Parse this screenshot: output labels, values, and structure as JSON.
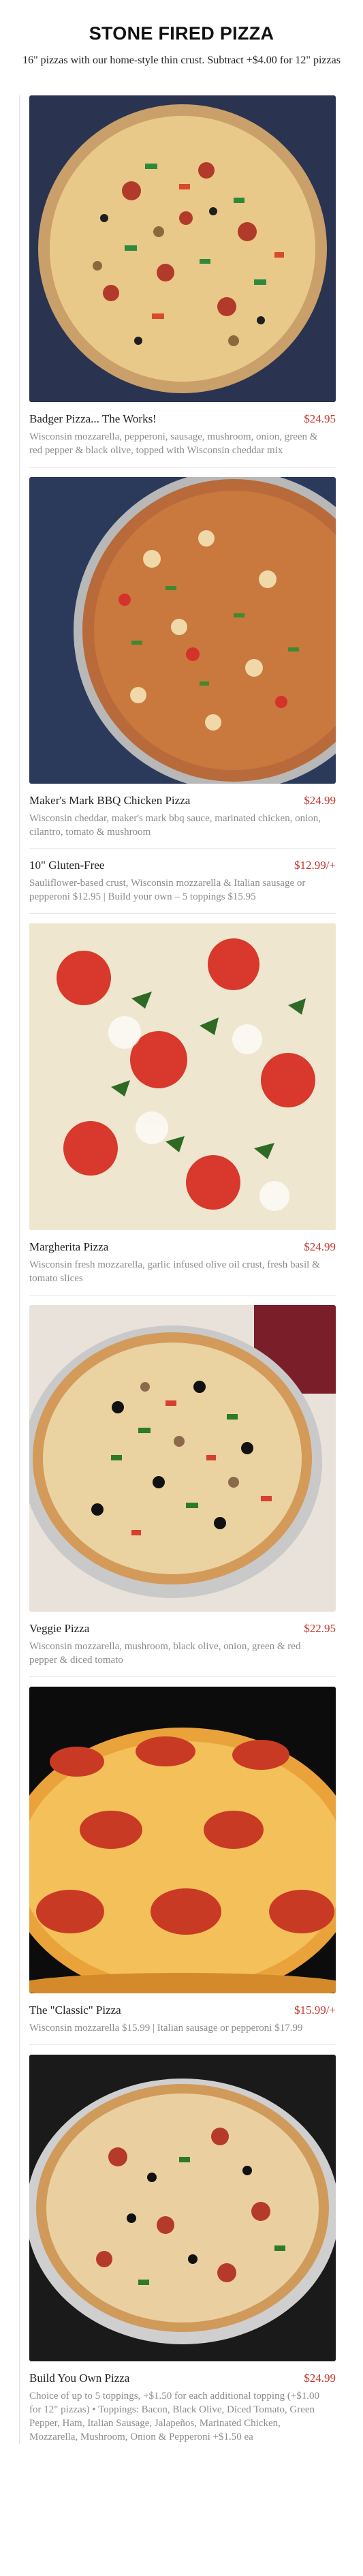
{
  "header": {
    "title": "STONE FIRED PIZZA",
    "subtitle": "16\" pizzas with our home-style thin crust. Subtract +$4.00 for 12\" pizzas"
  },
  "items": [
    {
      "name": "Badger Pizza... The Works!",
      "price": "$24.95",
      "description": "Wisconsin mozzarella, pepperoni, sausage, mushroom, onion, green & red pepper & black olive, topped with Wisconsin cheddar mix"
    },
    {
      "name": "Maker's Mark BBQ Chicken Pizza",
      "price": "$24.99",
      "description": "Wisconsin cheddar, maker's mark bbq sauce, marinated chicken, onion, cilantro, tomato & mushroom"
    },
    {
      "name": "10\" Gluten-Free",
      "price": "$12.99/+",
      "description": "Sauliflower-based crust, Wisconsin mozzarella & Italian sausage or pepperoni $12.95 | Build your own – 5 toppings $15.95"
    },
    {
      "name": "Margherita Pizza",
      "price": "$24.99",
      "description": "Wisconsin fresh mozzarella, garlic infused olive oil crust, fresh basil & tomato slices"
    },
    {
      "name": "Veggie Pizza",
      "price": "$22.95",
      "description": "Wisconsin mozzarella, mushroom, black olive, onion, green & red pepper & diced tomato"
    },
    {
      "name": "The \"Classic\" Pizza",
      "price": "$15.99/+",
      "description": "Wisconsin mozzarella $15.99 | Italian sausage or pepperoni $17.99"
    },
    {
      "name": "Build You Own Pizza",
      "price": "$24.99",
      "description": "Choice of up to 5 toppings, +$1.50 for each additional topping (+$1.00 for 12\" pizzas) • Toppings: Bacon, Black Olive, Diced Tomato, Green Pepper, Ham, Italian Sausage, Jalapeños, Marinated Chicken, Mozzarella, Mushroom, Onion & Pepperoni +$1.50 ea"
    }
  ],
  "colors": {
    "price": "#c7372f",
    "description": "#8c8c8c"
  }
}
